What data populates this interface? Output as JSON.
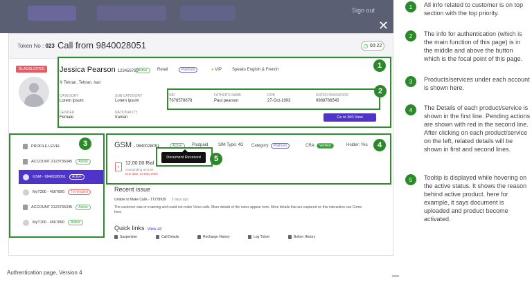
{
  "backdrop": {
    "right_label": "Sign out"
  },
  "modal": {
    "token_label": "Token No :",
    "token_value": "023",
    "call_title": "Call from 9840028051",
    "timer": "00:22",
    "blacklisted": "BLACKLISTED"
  },
  "customer": {
    "name": "Jessica Pearson",
    "id": "123456789",
    "status": "Active",
    "segment": "Retail",
    "tier": "Platinum",
    "vip": "VIP",
    "language": "Speaks English & French",
    "location": "Tehran, Tehran, Iran",
    "category_label": "CATEGORY",
    "category_value": "Lorem ipsum",
    "subcategory_label": "SUB CATEGORY",
    "subcategory_value": "Lorem ipsum",
    "gender_label": "GENDER",
    "gender_value": "Female",
    "nationality_label": "NATIONALITY",
    "nationality_value": "Iranian"
  },
  "auth": {
    "nid_label": "NID",
    "nid_value": "7678578678",
    "father_label": "FATHER'S NAME",
    "father_value": "Paul pearson",
    "dob_label": "DOB",
    "dob_value": "27-Oct-1993",
    "password_label": "ENTER PASSWORD",
    "password_value": "9988786545",
    "button": "Go to 360 View"
  },
  "sidebar": {
    "items": [
      {
        "label": "PROFILE LEVEL",
        "badge": ""
      },
      {
        "label": "ACCOUNT 2123736345",
        "badge": "Active"
      },
      {
        "label": "GSM - 9840028051",
        "badge": "Active"
      },
      {
        "label": "MyT200 - 4567890",
        "badge": "Terminated"
      },
      {
        "label": "ACCOUNT 2123736345",
        "badge": "Active"
      },
      {
        "label": "MyT100 - 4567890",
        "badge": "Active"
      }
    ]
  },
  "product": {
    "title": "GSM",
    "number": "- 9840028051",
    "status": "Active",
    "type": "Postpaid",
    "sim": "SIM Type: 4G",
    "category": "Category:",
    "category_value": "Platinum",
    "cra": "CRA:",
    "cra_value": "Verified",
    "holder": "Holder: Yes",
    "tooltip": "Document Received",
    "amount": "12,00.00 Rial",
    "outstanding": "Outstanding amount",
    "due": "Due date: 24 May 2020"
  },
  "recent_issue": {
    "title": "Recent issue",
    "issue": "Unable to Make Calls - TT278939",
    "ago": "5 days ago",
    "desc": "The customer was on roaming and could not make Voice calls. More details of the notes appear here. More details that are captured on this interaction can Come here."
  },
  "quick_links": {
    "title": "Quick links",
    "view_all": "View all",
    "items": [
      "Suspention",
      "Call Details",
      "Recharge History",
      "Log Ticket",
      "Bolton History"
    ]
  },
  "caption": "Authentication page, Version 4",
  "annotations": [
    {
      "num": "1",
      "text": "All info related to customer is on top section with the top priority."
    },
    {
      "num": "2",
      "text": "The info for authentication (which is the main function of this page) is in the middle and above the button which is the focal point of this page."
    },
    {
      "num": "3",
      "text": "Products/services under each account is shown here."
    },
    {
      "num": "4",
      "text": "The Details of each product/service is shown in the first line. Pending actions are shown with red in the second line. After clicking on each product/service on the left, related details will be shown in first and second lines."
    },
    {
      "num": "5",
      "text": "Tooltip is displayed while hovering on the active status. It shows the reason behind active product. here for example, it says document is uploaded and product become activated."
    }
  ],
  "colors": {
    "accent": "#4e35c8",
    "green": "#2a8a2a",
    "danger": "#e65a64"
  }
}
